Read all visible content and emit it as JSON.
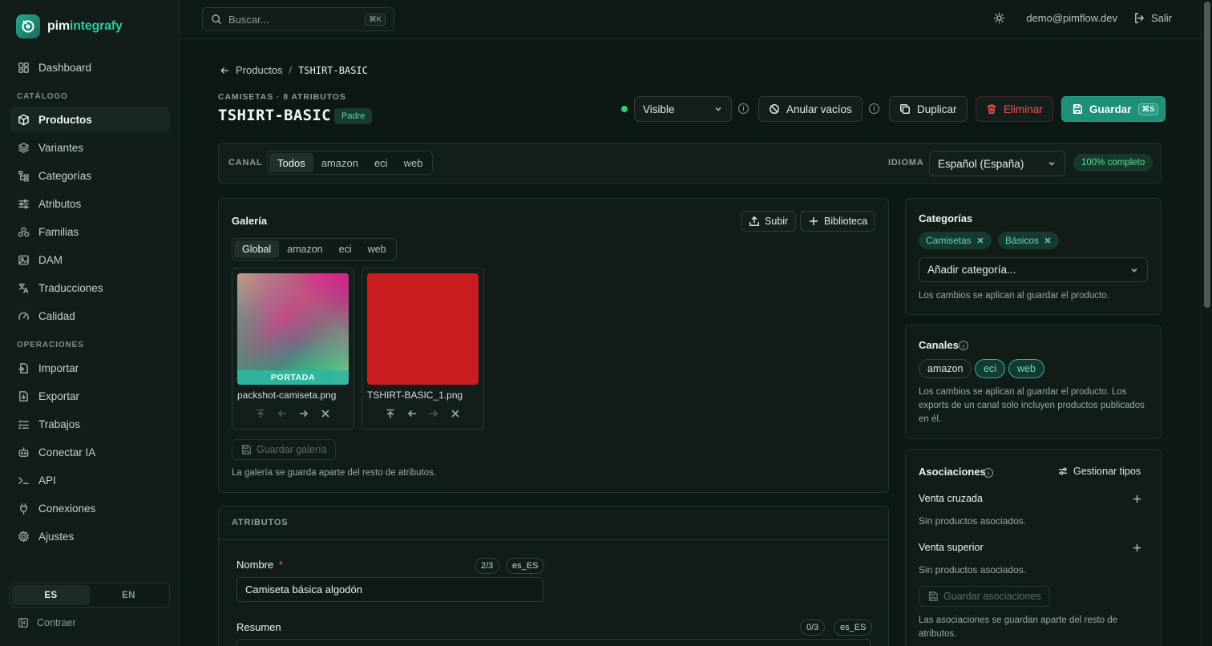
{
  "app": {
    "name_a": "pim",
    "name_b": "integrafy"
  },
  "nav": {
    "dashboard": "Dashboard",
    "catalog_section": "CATÁLOGO",
    "productos": "Productos",
    "variantes": "Variantes",
    "categorias": "Categorías",
    "atributos": "Atributos",
    "familias": "Familias",
    "dam": "DAM",
    "traducciones": "Traducciones",
    "calidad": "Calidad",
    "ops_section": "OPERACIONES",
    "importar": "Importar",
    "exportar": "Exportar",
    "trabajos": "Trabajos",
    "conectar_ia": "Conectar IA",
    "api": "API",
    "conexiones": "Conexiones",
    "ajustes": "Ajustes",
    "lang_es": "ES",
    "lang_en": "EN",
    "collapse": "Contraer"
  },
  "topbar": {
    "search_placeholder": "Buscar...",
    "search_kbd": "⌘K",
    "user_email": "demo@pimflow.dev",
    "logout": "Salir"
  },
  "breadcrumb": {
    "parent": "Productos",
    "sep": "/",
    "current": "TSHIRT-BASIC"
  },
  "product": {
    "subtitle": "CAMISETAS · 8 ATRIBUTOS",
    "title": "TSHIRT-BASIC",
    "badge": "Padre",
    "visibility": "Visible"
  },
  "actions": {
    "clear_empty": "Anular vacíos",
    "duplicate": "Duplicar",
    "delete": "Eliminar",
    "save": "Guardar",
    "save_kbd": "⌘S"
  },
  "channel_bar": {
    "channel_label": "CANAL",
    "channels": [
      "Todos",
      "amazon",
      "eci",
      "web"
    ],
    "selected_channel": "Todos",
    "language_label": "IDIOMA",
    "language": "Español (España)",
    "completeness": "100% completo"
  },
  "gallery": {
    "title": "Galería",
    "upload": "Subir",
    "library": "Biblioteca",
    "tabs": [
      "Global",
      "amazon",
      "eci",
      "web"
    ],
    "selected_tab": "Global",
    "images": [
      {
        "name": "packshot-camiseta.png",
        "cover_label": "PORTADA"
      },
      {
        "name": "TSHIRT-BASIC_1.png"
      }
    ],
    "save": "Guardar galería",
    "note": "La galería se guarda aparte del resto de atributos."
  },
  "attributes": {
    "section_title": "ATRIBUTOS",
    "name": {
      "label": "Nombre",
      "required": "*",
      "count": "2/3",
      "locale": "es_ES",
      "value": "Camiseta básica algodón"
    },
    "summary": {
      "label": "Resumen",
      "count": "0/3",
      "locale": "es_ES"
    }
  },
  "categories": {
    "title": "Categorías",
    "chips": [
      "Camisetas",
      "Básicos"
    ],
    "placeholder": "Añadir categoría...",
    "note": "Los cambios se aplican al guardar el producto."
  },
  "channels": {
    "title": "Canales",
    "items": [
      {
        "label": "amazon",
        "active": false
      },
      {
        "label": "eci",
        "active": true
      },
      {
        "label": "web",
        "active": true
      }
    ],
    "note": "Los cambios se aplican al guardar el producto. Los exports de un canal solo incluyen productos publicados en él."
  },
  "associations": {
    "title": "Asociaciones",
    "manage": "Gestionar tipos",
    "cross_sell": {
      "label": "Venta cruzada",
      "empty": "Sin productos asociados."
    },
    "up_sell": {
      "label": "Venta superior",
      "empty": "Sin productos asociados."
    },
    "save": "Guardar asociaciones",
    "note": "Las asociaciones se guardan aparte del resto de atributos."
  },
  "colors": {
    "accent": "#1f8f78",
    "danger": "#ef5350",
    "success": "#2fcf6e",
    "cover_overlay": "#2fb5a0"
  }
}
